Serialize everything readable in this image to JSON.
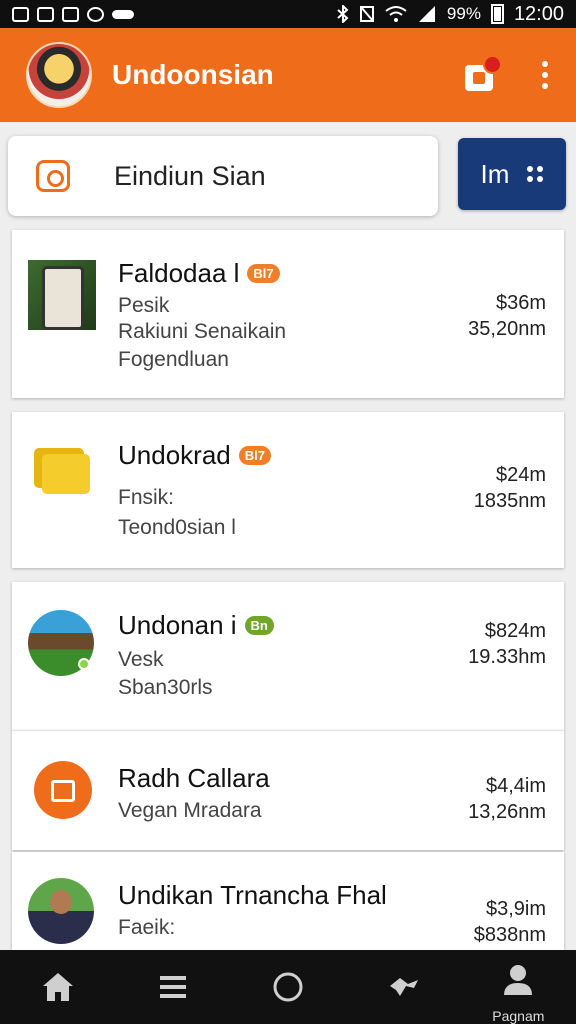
{
  "status_bar": {
    "battery_percent": "99%",
    "time": "12:00"
  },
  "app_bar": {
    "title": "Undoonsian"
  },
  "search": {
    "query": "Eindiun Sian",
    "filter_label": "Im"
  },
  "items": [
    {
      "name": "Faldodaa l",
      "tag": "Bl7",
      "lines": [
        "Pesik",
        "Rakiuni Senaikain",
        "Fogendluan"
      ],
      "price": "$36m",
      "distance": "35,20nm"
    },
    {
      "name": "Undokrad",
      "tag": "Bl7",
      "lines": [
        "Fnsik:",
        "Teond0sian l"
      ],
      "price": "$24m",
      "distance": "1835nm"
    },
    {
      "name": "Undonan i",
      "tag": "Bn",
      "lines": [
        "Vesk",
        "Sban30rls"
      ],
      "price": "$824m",
      "distance": "19.33hm"
    },
    {
      "name": "Radh Callara",
      "tag": "",
      "lines": [
        "Vegan Mradara"
      ],
      "price": "$4,4im",
      "distance": "13,26nm"
    },
    {
      "name": "Undikan Trnancha Fhal",
      "tag": "",
      "lines": [
        "Faeik:"
      ],
      "price": "$3,9im",
      "distance": "$838nm"
    }
  ],
  "bottom_nav": {
    "profile_label": "Pagnam"
  },
  "colors": {
    "brand_orange": "#ef6c1b",
    "filter_blue": "#183a78"
  },
  "icons": [
    "home-icon",
    "menu-list-icon",
    "circle-icon",
    "shuffle-icon",
    "profile-icon",
    "shopping-bag-icon",
    "more-vert-icon",
    "camera-icon",
    "share-nodes-icon"
  ]
}
